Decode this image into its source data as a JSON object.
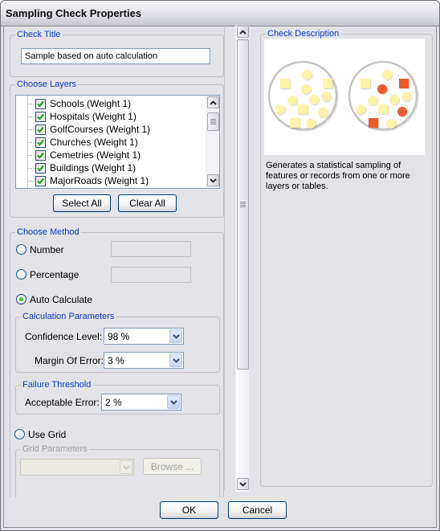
{
  "window": {
    "title": "Sampling Check Properties"
  },
  "check_title": {
    "legend": "Check Title",
    "value": "Sample based on auto calculation"
  },
  "choose_layers": {
    "legend": "Choose Layers",
    "layers": [
      {
        "label": "Schools (Weight 1)",
        "checked": true
      },
      {
        "label": "Hospitals (Weight 1)",
        "checked": true
      },
      {
        "label": "GolfCourses (Weight 1)",
        "checked": true
      },
      {
        "label": "Churches (Weight 1)",
        "checked": true
      },
      {
        "label": "Cemetries (Weight 1)",
        "checked": true
      },
      {
        "label": "Buildings (Weight 1)",
        "checked": true
      },
      {
        "label": "MajorRoads (Weight 1)",
        "checked": true
      }
    ],
    "select_all": "Select All",
    "clear_all": "Clear All"
  },
  "choose_method": {
    "legend": "Choose Method",
    "options": [
      {
        "label": "Number",
        "selected": false,
        "value": ""
      },
      {
        "label": "Percentage",
        "selected": false,
        "value": ""
      },
      {
        "label": "Auto Calculate",
        "selected": true
      }
    ],
    "calculation_parameters": {
      "legend": "Calculation Parameters",
      "confidence_level_label": "Confidence Level:",
      "confidence_level_value": "98 %",
      "margin_of_error_label": "Margin Of Error:",
      "margin_of_error_value": "3 %"
    },
    "failure_threshold": {
      "legend": "Failure Threshold",
      "acceptable_error_label": "Acceptable Error:",
      "acceptable_error_value": "2 %"
    },
    "use_grid": {
      "label": "Use Grid",
      "selected": false
    },
    "grid_parameters": {
      "legend": "Grid Parameters",
      "grid_value": "",
      "browse": "Browse ..."
    }
  },
  "check_description": {
    "legend": "Check Description",
    "text": "Generates a statistical sampling of features or records from one or more layers or tables.",
    "illustration": {
      "colors": {
        "population": "#fdf3a6",
        "sample": "#ec5a2a",
        "ring": "#c4c4c4"
      }
    }
  },
  "footer": {
    "ok": "OK",
    "cancel": "Cancel"
  },
  "icons": {
    "check": "✔",
    "chevron_up": "chevron-up-icon",
    "chevron_down": "chevron-down-icon"
  }
}
